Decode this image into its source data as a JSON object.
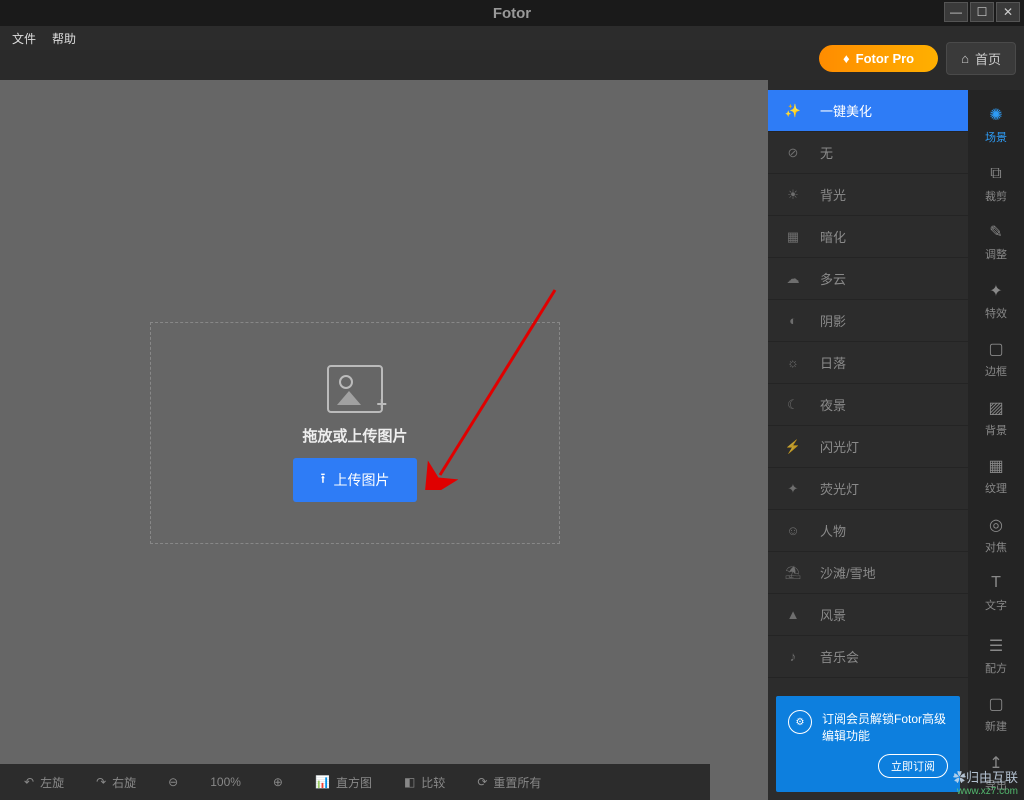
{
  "titlebar": {
    "title": "Fotor"
  },
  "menu": {
    "file": "文件",
    "help": "帮助"
  },
  "top": {
    "pro": "Fotor Pro",
    "home": "首页"
  },
  "upload": {
    "text": "拖放或上传图片",
    "button": "上传图片"
  },
  "scene_items": [
    {
      "label": "一键美化",
      "icon": "magic"
    },
    {
      "label": "无",
      "icon": "none"
    },
    {
      "label": "背光",
      "icon": "backlight"
    },
    {
      "label": "暗化",
      "icon": "darken"
    },
    {
      "label": "多云",
      "icon": "cloud"
    },
    {
      "label": "阴影",
      "icon": "shadow"
    },
    {
      "label": "日落",
      "icon": "sunset"
    },
    {
      "label": "夜景",
      "icon": "night"
    },
    {
      "label": "闪光灯",
      "icon": "flash"
    },
    {
      "label": "荧光灯",
      "icon": "fluorescent"
    },
    {
      "label": "人物",
      "icon": "portrait"
    },
    {
      "label": "沙滩/雪地",
      "icon": "beach"
    },
    {
      "label": "风景",
      "icon": "landscape"
    },
    {
      "label": "音乐会",
      "icon": "concert"
    }
  ],
  "strip": [
    {
      "label": "场景",
      "icon": "✺"
    },
    {
      "label": "裁剪",
      "icon": "⧉"
    },
    {
      "label": "调整",
      "icon": "✎"
    },
    {
      "label": "特效",
      "icon": "✦"
    },
    {
      "label": "边框",
      "icon": "▢"
    },
    {
      "label": "背景",
      "icon": "▨"
    },
    {
      "label": "纹理",
      "icon": "▦"
    },
    {
      "label": "对焦",
      "icon": "◎"
    },
    {
      "label": "文字",
      "icon": "T"
    }
  ],
  "strip_bottom": [
    {
      "label": "配方",
      "icon": "☰"
    },
    {
      "label": "新建",
      "icon": "▢"
    },
    {
      "label": "导出",
      "icon": "↥"
    }
  ],
  "promo": {
    "text": "订阅会员解锁Fotor高级编辑功能",
    "button": "立即订阅"
  },
  "bottom": {
    "rotate_left": "左旋",
    "rotate_right": "右旋",
    "zoom": "100%",
    "histogram": "直方图",
    "compare": "比较",
    "reset": "重置所有"
  },
  "watermark": {
    "main": "✿归由互联",
    "sub": "www.xz7.com"
  }
}
